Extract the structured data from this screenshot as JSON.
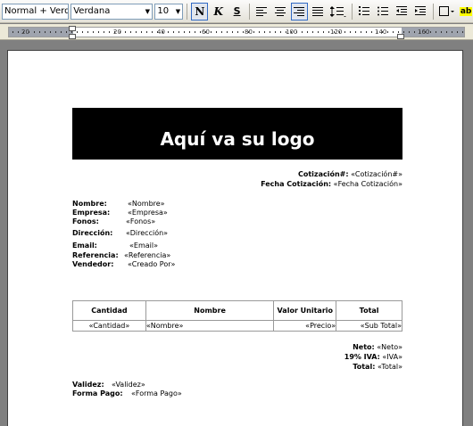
{
  "toolbar": {
    "style_value": "Normal + Verda",
    "font_value": "Verdana",
    "size_value": "10",
    "bold_label": "N",
    "italic_label": "K",
    "underline_label": "S",
    "highlight_label": "ab"
  },
  "ruler": {
    "labels": [
      "20",
      "20",
      "40",
      "60",
      "80",
      "100",
      "120",
      "140",
      "160"
    ]
  },
  "document": {
    "logo_text": "Aquí va su logo",
    "cotizacion_label": "Cotización#:",
    "cotizacion_value": "«Cotización#»",
    "fecha_label": "Fecha Cotización:",
    "fecha_value": "«Fecha Cotización»",
    "fields": [
      {
        "label": "Nombre:",
        "value": "«Nombre»"
      },
      {
        "label": "Empresa:",
        "value": "«Empresa»"
      },
      {
        "label": "Fonos:",
        "value": "«Fonos»"
      },
      {
        "label": "Dirección:",
        "value": "«Dirección»"
      },
      {
        "label": "Email:",
        "value": "«Email»"
      },
      {
        "label": "Referencia:",
        "value": "«Referencia»"
      },
      {
        "label": "Vendedor:",
        "value": "«Creado Por»"
      }
    ],
    "table": {
      "headers": [
        "Cantidad",
        "Nombre",
        "Valor Unitario",
        "Total"
      ],
      "row": [
        "«Cantidad»",
        "«Nombre»",
        "«Precio»",
        "«Sub Total»"
      ]
    },
    "totals": [
      {
        "label": "Neto:",
        "value": "«Neto»"
      },
      {
        "label": "19% IVA:",
        "value": "«IVA»"
      },
      {
        "label": "Total:",
        "value": "«Total»"
      }
    ],
    "validez_label": "Validez:",
    "validez_value": "«Validez»",
    "forma_pago_label": "Forma Pago:",
    "forma_pago_value": "«Forma Pago»"
  }
}
